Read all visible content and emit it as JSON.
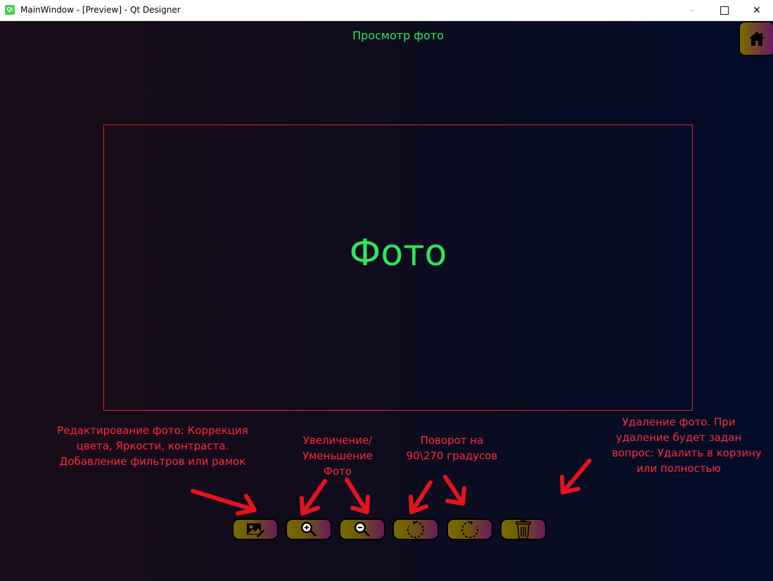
{
  "window": {
    "title": "MainWindow - [Preview] - Qt Designer",
    "app_icon": "qt-icon",
    "app_icon_text": "Qt",
    "controls": {
      "minimize": "–",
      "close": "✕"
    }
  },
  "header": {
    "title": "Просмотр фото",
    "home_icon": "home-icon"
  },
  "photo": {
    "placeholder": "Фото",
    "frame_color": "#e52424"
  },
  "annotations": {
    "edit": [
      "Редактирование фото: Коррекция",
      "цвета, Яркости, контраста.",
      "Добавление фильтров или рамок"
    ],
    "zoom": [
      "Увеличение/",
      "Уменьшение",
      "Фото"
    ],
    "rotate": [
      "Поворот на",
      "90\\270 градусов"
    ],
    "delete": [
      "Удаление фото. При",
      "удаление будет задан",
      "вопрос: Удалить в корзину",
      "или полностью"
    ]
  },
  "toolbar": {
    "buttons": [
      {
        "name": "edit-photo",
        "icon": "image-edit-icon"
      },
      {
        "name": "zoom-in",
        "icon": "zoom-in-icon"
      },
      {
        "name": "zoom-out",
        "icon": "zoom-out-icon"
      },
      {
        "name": "rotate-right",
        "icon": "rotate-right-icon"
      },
      {
        "name": "rotate-left",
        "icon": "rotate-left-icon"
      },
      {
        "name": "delete",
        "icon": "trash-icon"
      }
    ]
  },
  "colors": {
    "accent_green": "#2ee75a",
    "annotation_red": "#ff2a3a",
    "button_gold": "#7a6b00",
    "button_magenta": "#6a1860"
  }
}
